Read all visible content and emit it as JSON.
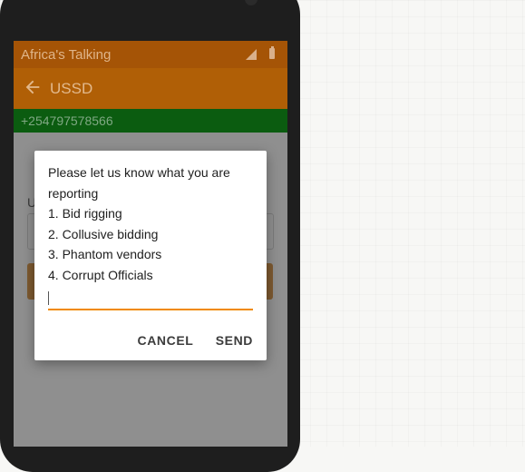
{
  "status_bar": {
    "title": "Africa's Talking",
    "icons": [
      "signal-icon",
      "battery-icon"
    ]
  },
  "app_bar": {
    "title": "USSD",
    "back_icon": "arrow-back-icon",
    "color": "#b05f06"
  },
  "phone_bar": {
    "number": "+254797578566",
    "color": "#0b5c10"
  },
  "background_form": {
    "label_fragment": "U"
  },
  "dialog": {
    "message_lines": [
      "Please let us know what you are reporting",
      "1. Bid rigging",
      "2. Collusive bidding",
      "3. Phantom vendors",
      "4. Corrupt Officials"
    ],
    "input_value": "",
    "cancel_label": "CANCEL",
    "send_label": "SEND",
    "accent_color": "#f08a00"
  }
}
